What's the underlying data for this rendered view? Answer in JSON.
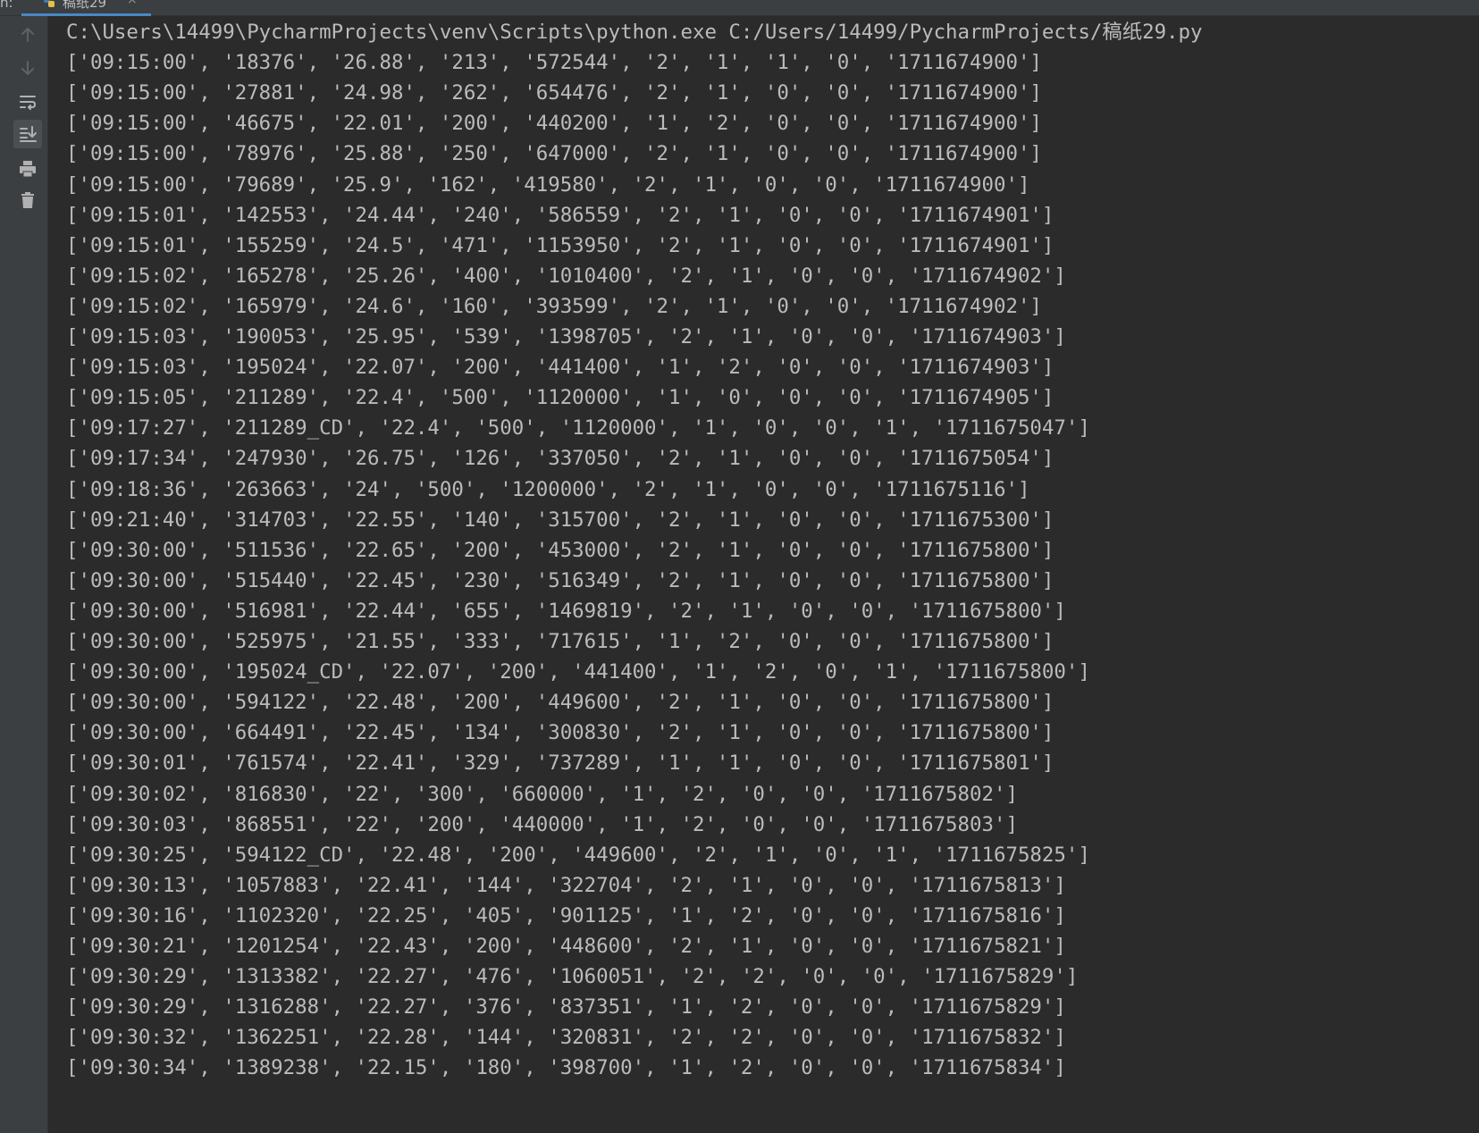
{
  "tabs": {
    "run_prefix": "n:",
    "active_tab_label": "稿纸29",
    "close_glyph": "×",
    "tab_icon": "python-file-icon"
  },
  "toolbar": {
    "tools": [
      {
        "name": "up-arrow-icon",
        "active": false
      },
      {
        "name": "down-arrow-icon",
        "active": false
      },
      {
        "name": "soft-wrap-icon",
        "active": false
      },
      {
        "name": "scroll-to-end-icon",
        "active": true
      },
      {
        "name": "print-icon",
        "active": false
      },
      {
        "name": "trash-icon",
        "active": false
      }
    ]
  },
  "console": {
    "command": "C:\\Users\\14499\\PycharmProjects\\venv\\Scripts\\python.exe C:/Users/14499/PycharmProjects/稿纸29.py",
    "lines": [
      "['09:15:00', '18376', '26.88', '213', '572544', '2', '1', '1', '0', '1711674900']",
      "['09:15:00', '27881', '24.98', '262', '654476', '2', '1', '0', '0', '1711674900']",
      "['09:15:00', '46675', '22.01', '200', '440200', '1', '2', '0', '0', '1711674900']",
      "['09:15:00', '78976', '25.88', '250', '647000', '2', '1', '0', '0', '1711674900']",
      "['09:15:00', '79689', '25.9', '162', '419580', '2', '1', '0', '0', '1711674900']",
      "['09:15:01', '142553', '24.44', '240', '586559', '2', '1', '0', '0', '1711674901']",
      "['09:15:01', '155259', '24.5', '471', '1153950', '2', '1', '0', '0', '1711674901']",
      "['09:15:02', '165278', '25.26', '400', '1010400', '2', '1', '0', '0', '1711674902']",
      "['09:15:02', '165979', '24.6', '160', '393599', '2', '1', '0', '0', '1711674902']",
      "['09:15:03', '190053', '25.95', '539', '1398705', '2', '1', '0', '0', '1711674903']",
      "['09:15:03', '195024', '22.07', '200', '441400', '1', '2', '0', '0', '1711674903']",
      "['09:15:05', '211289', '22.4', '500', '1120000', '1', '0', '0', '0', '1711674905']",
      "['09:17:27', '211289_CD', '22.4', '500', '1120000', '1', '0', '0', '1', '1711675047']",
      "['09:17:34', '247930', '26.75', '126', '337050', '2', '1', '0', '0', '1711675054']",
      "['09:18:36', '263663', '24', '500', '1200000', '2', '1', '0', '0', '1711675116']",
      "['09:21:40', '314703', '22.55', '140', '315700', '2', '1', '0', '0', '1711675300']",
      "['09:30:00', '511536', '22.65', '200', '453000', '2', '1', '0', '0', '1711675800']",
      "['09:30:00', '515440', '22.45', '230', '516349', '2', '1', '0', '0', '1711675800']",
      "['09:30:00', '516981', '22.44', '655', '1469819', '2', '1', '0', '0', '1711675800']",
      "['09:30:00', '525975', '21.55', '333', '717615', '1', '2', '0', '0', '1711675800']",
      "['09:30:00', '195024_CD', '22.07', '200', '441400', '1', '2', '0', '1', '1711675800']",
      "['09:30:00', '594122', '22.48', '200', '449600', '2', '1', '0', '0', '1711675800']",
      "['09:30:00', '664491', '22.45', '134', '300830', '2', '1', '0', '0', '1711675800']",
      "['09:30:01', '761574', '22.41', '329', '737289', '1', '1', '0', '0', '1711675801']",
      "['09:30:02', '816830', '22', '300', '660000', '1', '2', '0', '0', '1711675802']",
      "['09:30:03', '868551', '22', '200', '440000', '1', '2', '0', '0', '1711675803']",
      "['09:30:25', '594122_CD', '22.48', '200', '449600', '2', '1', '0', '1', '1711675825']",
      "['09:30:13', '1057883', '22.41', '144', '322704', '2', '1', '0', '0', '1711675813']",
      "['09:30:16', '1102320', '22.25', '405', '901125', '1', '2', '0', '0', '1711675816']",
      "['09:30:21', '1201254', '22.43', '200', '448600', '2', '1', '0', '0', '1711675821']",
      "['09:30:29', '1313382', '22.27', '476', '1060051', '2', '2', '0', '0', '1711675829']",
      "['09:30:29', '1316288', '22.27', '376', '837351', '1', '2', '0', '0', '1711675829']",
      "['09:30:32', '1362251', '22.28', '144', '320831', '2', '2', '0', '0', '1711675832']",
      "['09:30:34', '1389238', '22.15', '180', '398700', '1', '2', '0', '0', '1711675834']"
    ]
  }
}
